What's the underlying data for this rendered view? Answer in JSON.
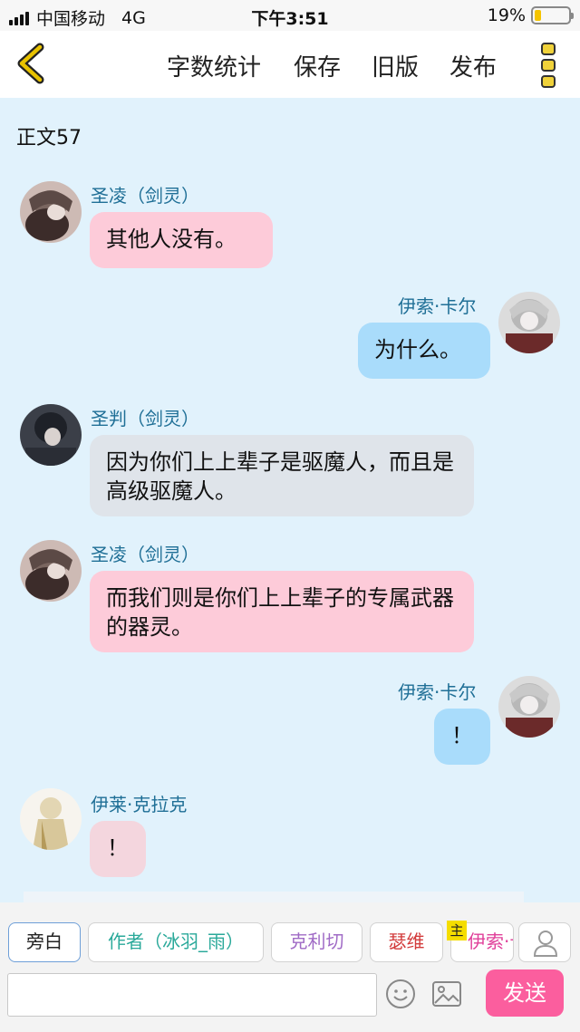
{
  "status_bar": {
    "carrier": "中国移动",
    "network": "4G",
    "time": "下午3:51",
    "battery_percent": "19%",
    "battery_level": 0.19
  },
  "nav": {
    "back_icon": "chevron-left-icon",
    "actions": [
      "字数统计",
      "保存",
      "旧版",
      "发布"
    ],
    "menu_icon": "more-vertical-icon",
    "accent": "#e8c200"
  },
  "word_count": "正文57",
  "messages": [
    {
      "side": "left",
      "name": "圣凌（剑灵）",
      "text": "其他人没有。",
      "color": "#fdcbd9"
    },
    {
      "side": "right",
      "name": "伊索·卡尔",
      "text": "为什么。",
      "color": "#a9dcfb"
    },
    {
      "side": "left",
      "name": "圣判（剑灵）",
      "text": "因为你们上上辈子是驱魔人，而且是高级驱魔人。",
      "color": "#dfe4ea"
    },
    {
      "side": "left",
      "name": "圣凌（剑灵）",
      "text": "而我们则是你们上上辈子的专属武器的器灵。",
      "color": "#fdcbd9"
    },
    {
      "side": "right",
      "name": "伊索·卡尔",
      "text": "！",
      "color": "#a9dcfb"
    },
    {
      "side": "left",
      "name": "伊莱·克拉克",
      "text": "！",
      "color": "#f4d6de"
    }
  ],
  "toolbar": {
    "roles": [
      "旁白",
      "作者（冰羽_雨）",
      "克利切",
      "瑟维",
      "伊索·卡尔"
    ],
    "role_colors": [
      "#222222",
      "#2aa99a",
      "#a06bc6",
      "#d23b3b",
      "#e0409a"
    ],
    "host_badge": "主",
    "manage_icon": "user-icon",
    "input_placeholder": "",
    "emoji_icon": "emoji-icon",
    "image_icon": "image-icon",
    "send_label": "发送",
    "send_color": "#fb5e9e"
  }
}
